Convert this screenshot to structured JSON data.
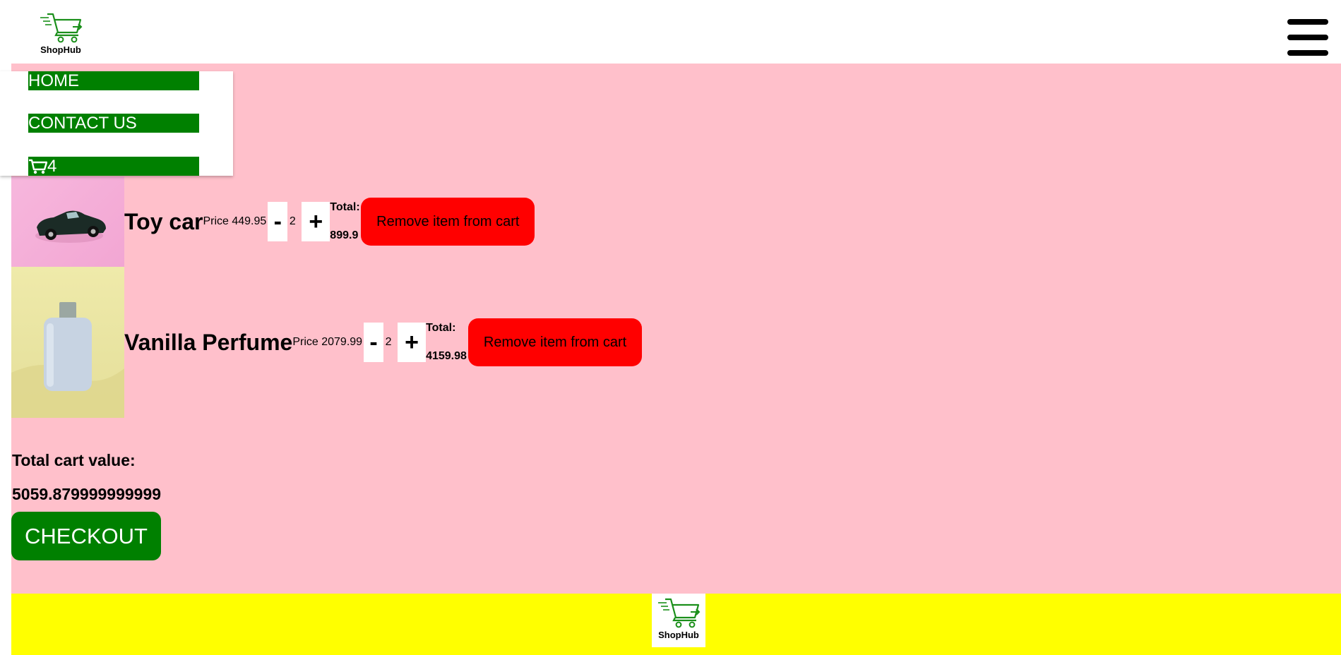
{
  "brand": {
    "logo_text": "ShopHub",
    "primary_color": "#008000"
  },
  "header": {
    "menu_icon": "hamburger-icon"
  },
  "nav": {
    "home_label": "HOME",
    "contact_label": "CONTACT US",
    "cart_icon": "cart-icon",
    "cart_count": "4"
  },
  "cart": {
    "items": [
      {
        "name": "Toy car",
        "price_label": "Price 449.95",
        "minus_label": "-",
        "quantity": "2",
        "plus_label": "+",
        "total_label": "Total:",
        "total_value": "899.9",
        "remove_label": "Remove item from cart"
      },
      {
        "name": "Vanilla Perfume",
        "price_label": "Price 2079.99",
        "minus_label": "-",
        "quantity": "2",
        "plus_label": "+",
        "total_label": "Total:",
        "total_value": "4159.98",
        "remove_label": "Remove item from cart"
      }
    ],
    "total_label": "Total cart value:",
    "total_value": "5059.879999999999",
    "checkout_label": "CHECKOUT"
  },
  "colors": {
    "page_bg": "#ffc0cb",
    "footer_bg": "#ffff00",
    "remove_bg": "#ff0000"
  }
}
